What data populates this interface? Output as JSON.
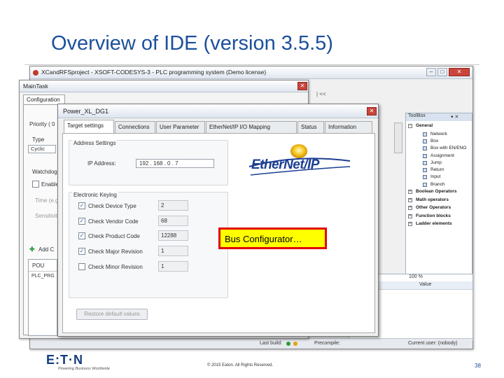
{
  "slide": {
    "title": "Overview of IDE (version 3.5.5)",
    "copyright": "© 2015 Eaton. All Rights Reserved.",
    "page_number": "38",
    "company": "E:T·N",
    "tagline": "Powering Business Worldwide"
  },
  "ide": {
    "title": "XCandRFSproject - XSOFT-CODESYS-3 - PLC programming system (Demo license)",
    "toolbar_text": "| <<",
    "toolbox": {
      "header": "ToolBox",
      "items": [
        {
          "label": "General",
          "category": true
        },
        {
          "label": "Network",
          "category": false
        },
        {
          "label": "Box",
          "category": false
        },
        {
          "label": "Box with EN/ENO",
          "category": false
        },
        {
          "label": "Assignment",
          "category": false
        },
        {
          "label": "Jump",
          "category": false
        },
        {
          "label": "Return",
          "category": false
        },
        {
          "label": "Input",
          "category": false
        },
        {
          "label": "Branch",
          "category": false
        },
        {
          "label": "Boolean Operators",
          "category": true
        },
        {
          "label": "Math operators",
          "category": true
        },
        {
          "label": "Other Operators",
          "category": true
        },
        {
          "label": "Function blocks",
          "category": true
        },
        {
          "label": "Ladder elements",
          "category": true
        }
      ]
    },
    "watch": {
      "zoom": "100 %",
      "col_value": "Value"
    },
    "status": {
      "last_build": "Last build:",
      "precompile": "Precompile:",
      "current_user": "Current user: (nobody)"
    }
  },
  "main_task": {
    "title": "MainTask",
    "tab": "Configuration",
    "priority_label": "Priority ( 0",
    "type_label": "Type",
    "type_value": "Cyclic",
    "watchdog_label": "Watchdog",
    "enable_label": "Enable",
    "time_label": "Time (e.g.",
    "sensitivity_label": "Sensitivity",
    "add_call_label": "Add C",
    "pou_header": "POU",
    "pou_item": "PLC_PRG"
  },
  "dialog": {
    "title": "Power_XL_DG1",
    "tabs": [
      "Target settings",
      "Connections",
      "User Parameter",
      "EtherNet/IP I/O Mapping",
      "Status",
      "Information"
    ],
    "active_tab": 0,
    "address_settings": {
      "title": "Address Settings",
      "ip_label": "IP Address:",
      "ip_value": "192 . 168 . 0 . 7"
    },
    "logo_text": "EtherNet/IP",
    "electronic_keying": {
      "title": "Electronic Keying",
      "rows": [
        {
          "label": "Check Device Type",
          "checked": true,
          "value": "2"
        },
        {
          "label": "Check Vendor Code",
          "checked": true,
          "value": "68"
        },
        {
          "label": "Check Product Code",
          "checked": true,
          "value": "12288"
        },
        {
          "label": "Check Major Revision",
          "checked": true,
          "value": "1"
        },
        {
          "label": "Check Minor Revision",
          "checked": false,
          "value": "1"
        }
      ]
    },
    "restore_label": "Restore default values"
  },
  "callout": {
    "text": "Bus Configurator…",
    "fill": "#ffff00",
    "border": "#e1000f"
  }
}
